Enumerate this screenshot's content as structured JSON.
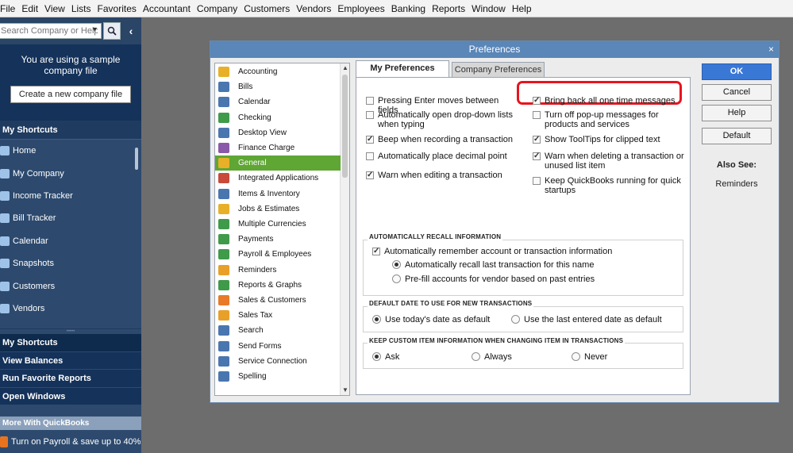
{
  "menubar": {
    "items": [
      "File",
      "Edit",
      "View",
      "Lists",
      "Favorites",
      "Accountant",
      "Company",
      "Customers",
      "Vendors",
      "Employees",
      "Banking",
      "Reports",
      "Window",
      "Help"
    ]
  },
  "leftnav": {
    "search_placeholder": "Search Company or Help",
    "sample_text": "You are using a sample company file",
    "create_company_label": "Create a new company file",
    "shortcuts_header": "My Shortcuts",
    "shortcuts": [
      {
        "label": "Home",
        "color": "#9fc3e8"
      },
      {
        "label": "My Company",
        "color": "#9fc3e8"
      },
      {
        "label": "Income Tracker",
        "color": "#9fc3e8"
      },
      {
        "label": "Bill Tracker",
        "color": "#9fc3e8"
      },
      {
        "label": "Calendar",
        "color": "#9fc3e8"
      },
      {
        "label": "Snapshots",
        "color": "#9fc3e8"
      },
      {
        "label": "Customers",
        "color": "#9fc3e8"
      },
      {
        "label": "Vendors",
        "color": "#9fc3e8"
      }
    ],
    "tabs": [
      "My Shortcuts",
      "View Balances",
      "Run Favorite Reports",
      "Open Windows"
    ],
    "more_header": "More With QuickBooks",
    "promo_text": "Turn on Payroll & save up to 40%"
  },
  "dialog": {
    "title": "Preferences",
    "close_glyph": "×",
    "categories": [
      {
        "label": "Accounting",
        "color": "#e8b028"
      },
      {
        "label": "Bills",
        "color": "#4a76b0"
      },
      {
        "label": "Calendar",
        "color": "#4a76b0"
      },
      {
        "label": "Checking",
        "color": "#3f9a4a"
      },
      {
        "label": "Desktop View",
        "color": "#4a76b0"
      },
      {
        "label": "Finance Charge",
        "color": "#8a5aa8"
      },
      {
        "label": "General",
        "color": "#e8b028"
      },
      {
        "label": "Integrated Applications",
        "color": "#c84a3a"
      },
      {
        "label": "Items & Inventory",
        "color": "#4a76b0"
      },
      {
        "label": "Jobs & Estimates",
        "color": "#e8b028"
      },
      {
        "label": "Multiple Currencies",
        "color": "#3f9a4a"
      },
      {
        "label": "Payments",
        "color": "#3f9a4a"
      },
      {
        "label": "Payroll & Employees",
        "color": "#3f9a4a"
      },
      {
        "label": "Reminders",
        "color": "#e8a028"
      },
      {
        "label": "Reports & Graphs",
        "color": "#3f9a4a"
      },
      {
        "label": "Sales & Customers",
        "color": "#e87a28"
      },
      {
        "label": "Sales Tax",
        "color": "#e8a028"
      },
      {
        "label": "Search",
        "color": "#4a76b0"
      },
      {
        "label": "Send Forms",
        "color": "#4a76b0"
      },
      {
        "label": "Service Connection",
        "color": "#4a76b0"
      },
      {
        "label": "Spelling",
        "color": "#4a76b0"
      }
    ],
    "selected_category": "General",
    "tabs": {
      "my": "My Preferences",
      "company": "Company Preferences"
    },
    "left_options": [
      {
        "label": "Pressing Enter moves between fields",
        "checked": false
      },
      {
        "label": "Automatically open drop-down lists when typing",
        "checked": false
      },
      {
        "label": "Beep when recording a transaction",
        "checked": true
      },
      {
        "label": "Automatically place decimal point",
        "checked": false
      },
      {
        "label": "Warn when editing a transaction",
        "checked": true
      }
    ],
    "right_options": [
      {
        "label": "Bring back all one time messages",
        "checked": true
      },
      {
        "label": "Turn off pop-up messages for products and services",
        "checked": false
      },
      {
        "label": "Show ToolTips for clipped text",
        "checked": true
      },
      {
        "label": "Warn when deleting a transaction or unused list item",
        "checked": true
      },
      {
        "label": "Keep QuickBooks running for quick startups",
        "checked": false
      }
    ],
    "recall": {
      "title": "AUTOMATICALLY RECALL INFORMATION",
      "main_label": "Automatically remember account or transaction information",
      "main_checked": true,
      "options": [
        {
          "label": "Automatically recall last transaction for this name",
          "selected": true
        },
        {
          "label": "Pre-fill accounts for vendor based on past entries",
          "selected": false
        }
      ]
    },
    "default_date": {
      "title": "DEFAULT DATE TO USE FOR NEW TRANSACTIONS",
      "options": [
        {
          "label": "Use today's date as default",
          "selected": true
        },
        {
          "label": "Use the last entered date as default",
          "selected": false
        }
      ]
    },
    "custom_item": {
      "title": "KEEP CUSTOM ITEM INFORMATION WHEN CHANGING ITEM IN TRANSACTIONS",
      "options": [
        {
          "label": "Ask",
          "selected": true
        },
        {
          "label": "Always",
          "selected": false
        },
        {
          "label": "Never",
          "selected": false
        }
      ]
    },
    "buttons": {
      "ok": "OK",
      "cancel": "Cancel",
      "help": "Help",
      "default": "Default"
    },
    "also_see": "Also See:",
    "also_see_link": "Reminders",
    "highlight_color": "#e8141e"
  }
}
